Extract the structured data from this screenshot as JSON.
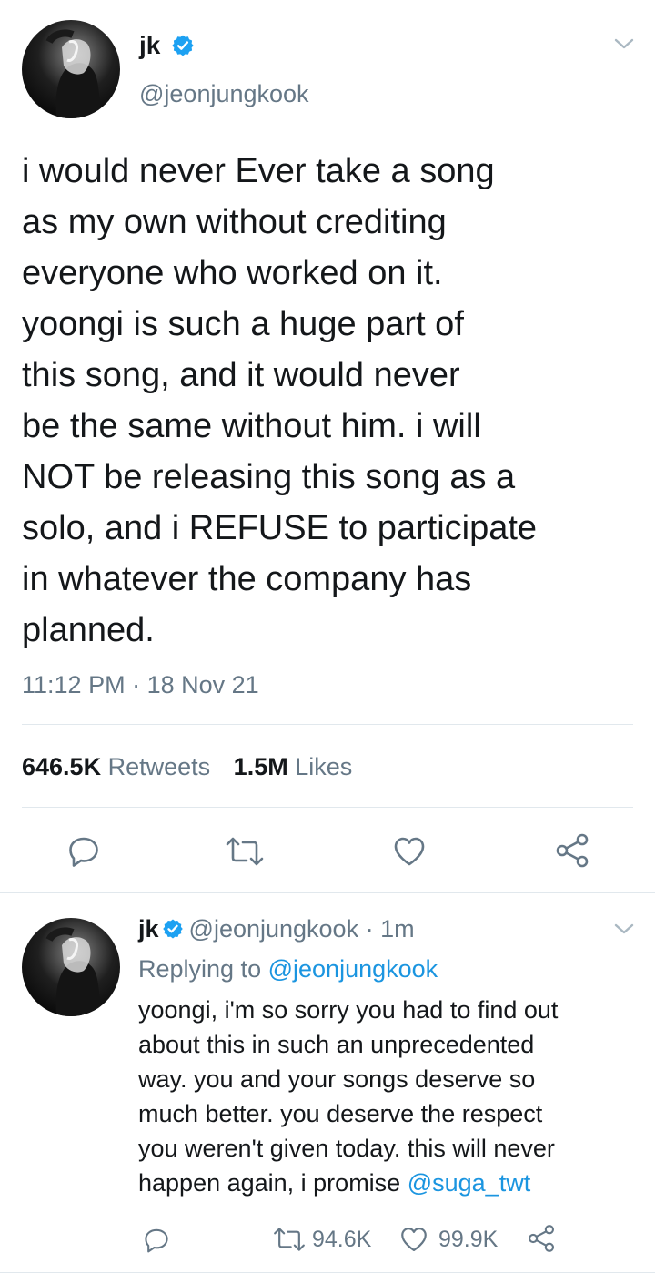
{
  "main_tweet": {
    "display_name": "jk",
    "handle": "@jeonjungkook",
    "text_lines": [
      "i would never Ever take a song",
      "as my own without crediting",
      "everyone who worked on it.",
      "yoongi is such a huge part of",
      "this song, and it would never",
      "be the same without him. i will",
      "NOT be releasing this song as a",
      "solo, and i REFUSE to participate",
      "in whatever the company has",
      "planned."
    ],
    "time": "11:12 PM",
    "date": "18 Nov 21",
    "retweets_count": "646.5K",
    "retweets_label": "Retweets",
    "likes_count": "1.5M",
    "likes_label": "Likes"
  },
  "reply_tweet": {
    "display_name": "jk",
    "handle": "@jeonjungkook",
    "separator": "·",
    "age": "1m",
    "replying_prefix": "Replying to",
    "replying_handle": "@jeonjungkook",
    "text_lines": [
      "yoongi, i'm so sorry you had to find out",
      "about this in such an unprecedented",
      "way. you and your songs deserve so",
      "much better. you deserve the respect",
      "you weren't given today. this will never"
    ],
    "last_line_text": "happen again, i promise",
    "mention": "@suga_twt",
    "retweet_count": "94.6K",
    "like_count": "99.9K"
  },
  "colors": {
    "text": "#14171a",
    "secondary": "#657786",
    "link": "#1b95e0",
    "divider": "#e1e8ed",
    "verified": "#1da1f2"
  },
  "icons": {
    "main": [
      "chevron-down-icon",
      "verified-badge-icon",
      "reply-icon",
      "retweet-icon",
      "like-icon",
      "share-icon"
    ],
    "reply": [
      "chevron-down-icon",
      "verified-badge-icon",
      "reply-icon",
      "retweet-icon",
      "like-icon",
      "share-icon"
    ]
  }
}
